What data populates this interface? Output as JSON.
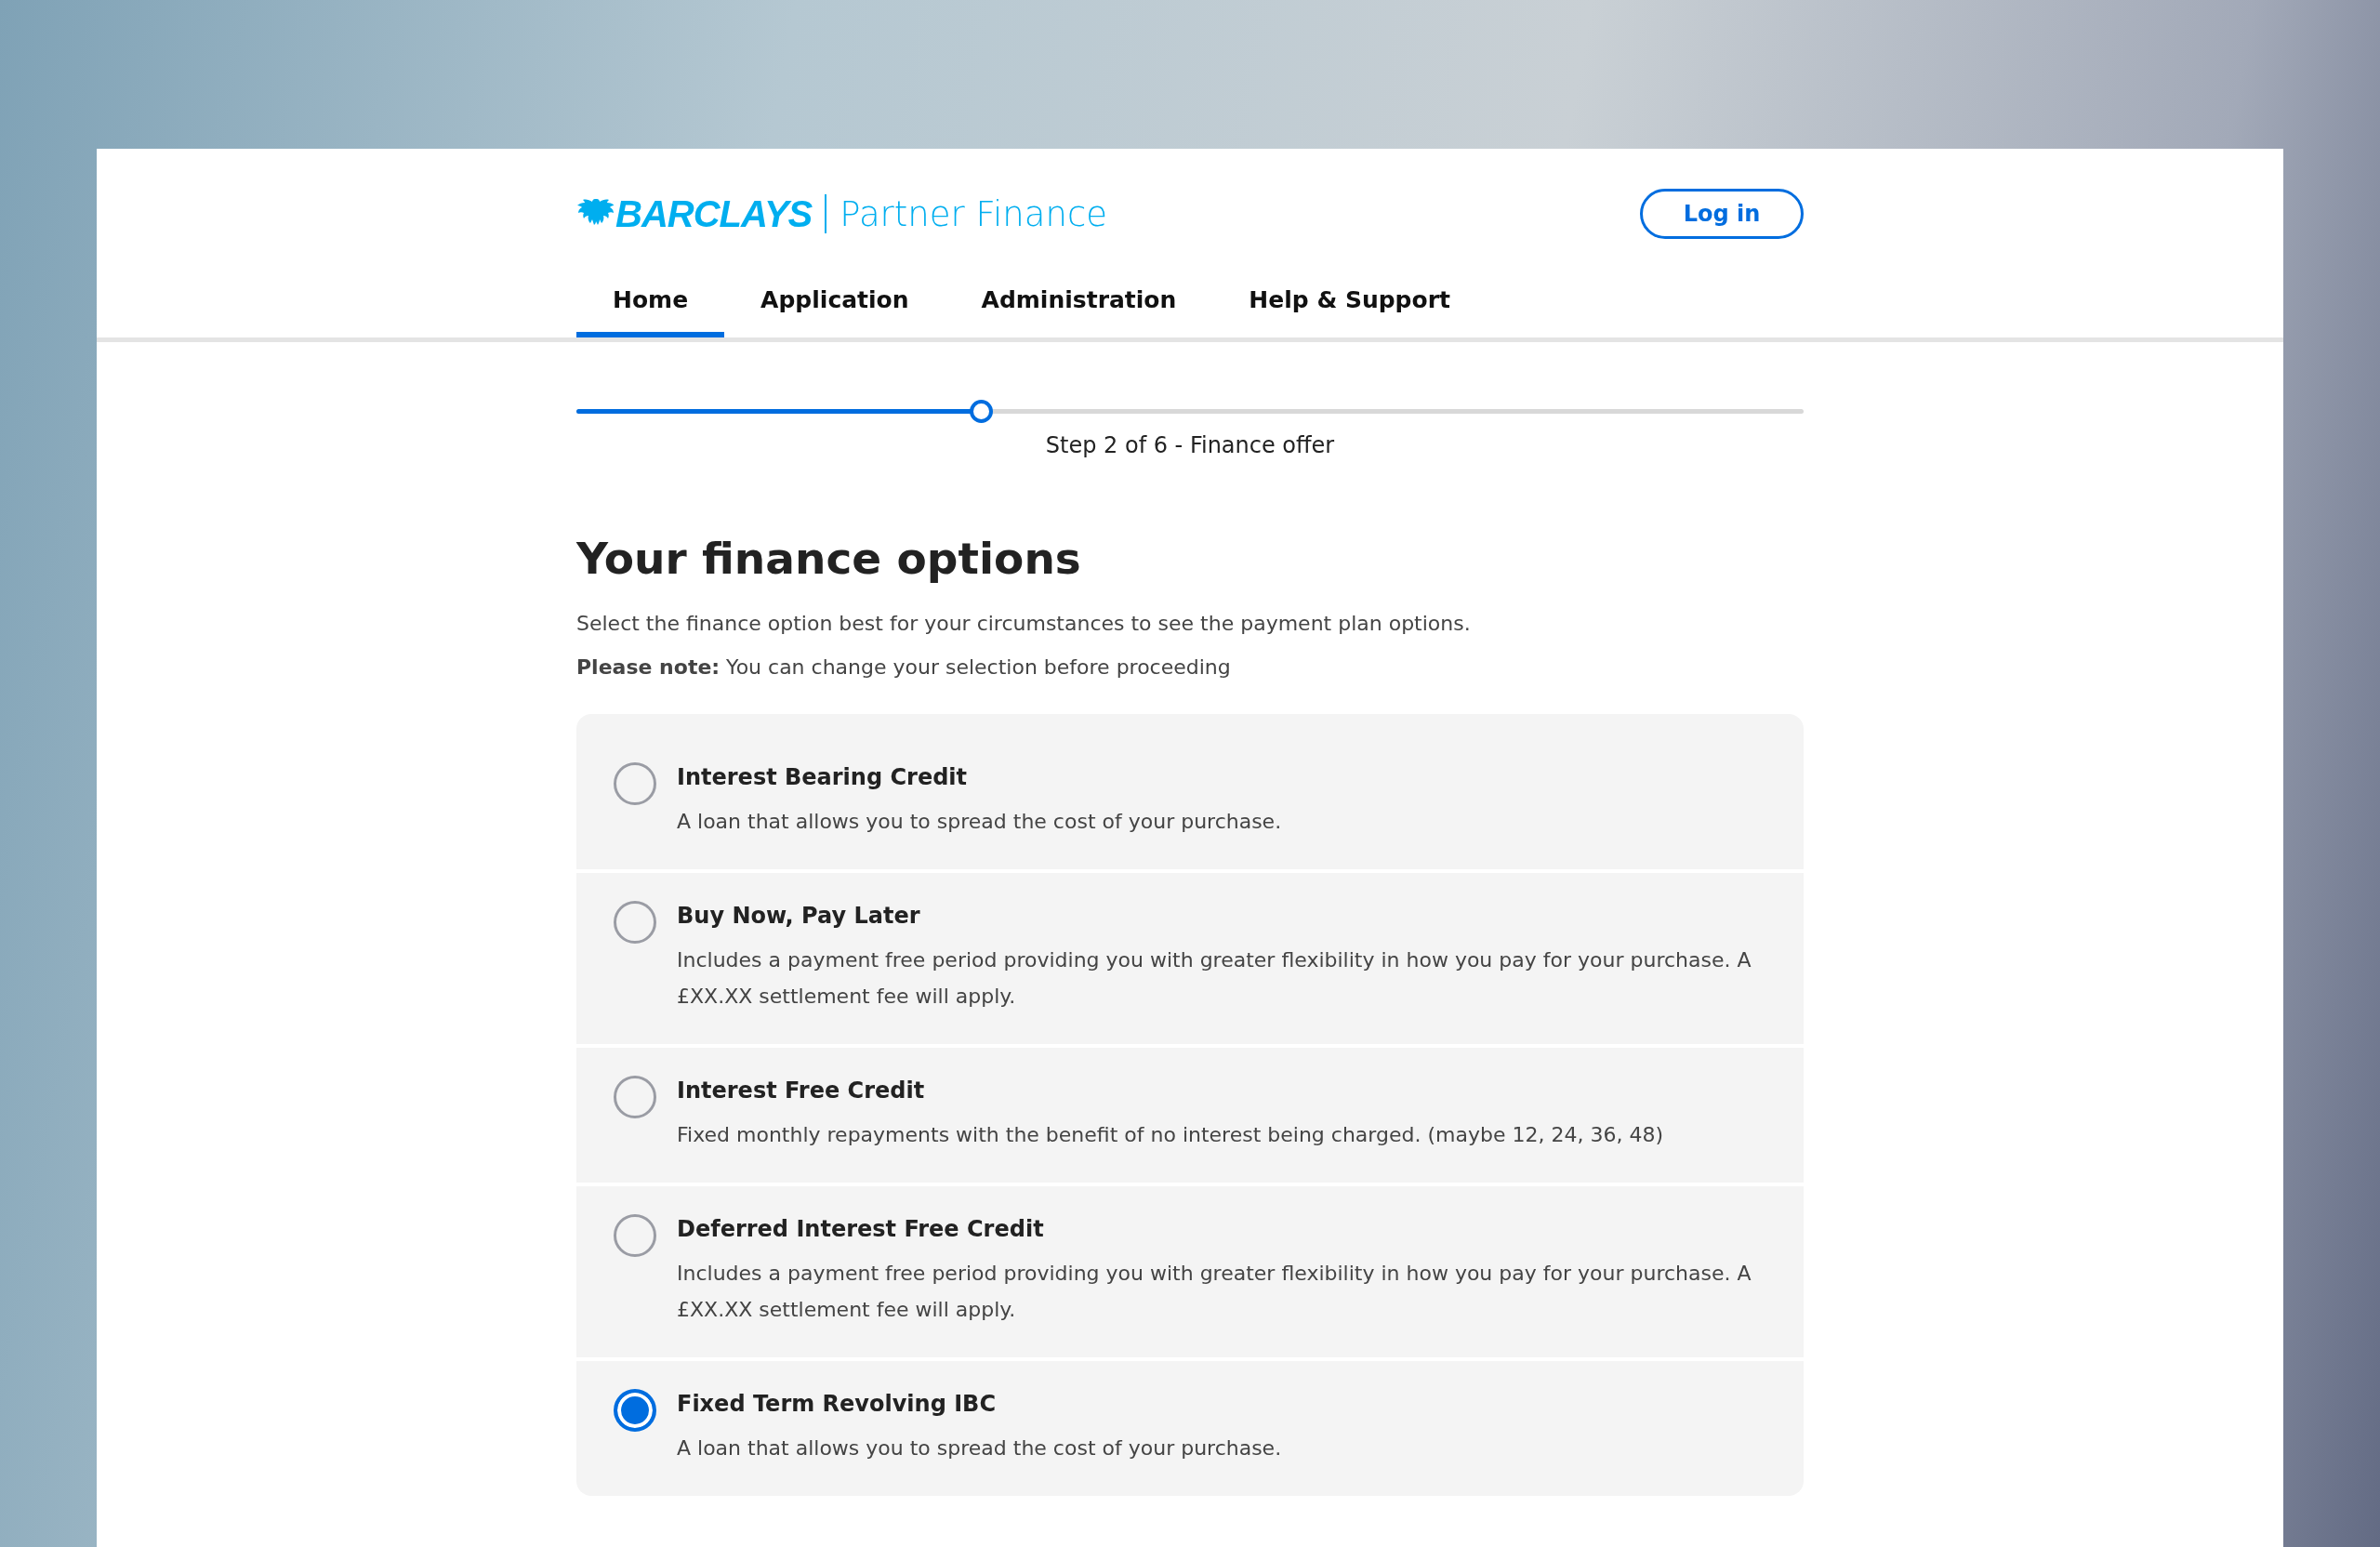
{
  "header": {
    "logo_text": "BARCLAYS",
    "product": "Partner Finance",
    "login_button": "Log in"
  },
  "nav": [
    {
      "label": "Home",
      "selected": true
    },
    {
      "label": "Application",
      "selected": false
    },
    {
      "label": "Administration",
      "selected": false
    },
    {
      "label": "Help & Support",
      "selected": false
    }
  ],
  "progress": {
    "level": 0.33,
    "label": "Step 2 of 6 - Finance offer"
  },
  "heading": "Your finance options",
  "intro": "Select the finance option best for your circumstances to see the payment plan options.",
  "note": "**Please note:** You can change your selection before proceeding",
  "options": [
    {
      "title": "Interest Bearing Credit",
      "description": "A loan that allows you to spread the cost of your purchase.",
      "selected": false
    },
    {
      "title": "Buy Now, Pay Later",
      "description": "Includes a payment free period providing you with greater flexibility in how you pay for your purchase. A £XX.XX settlement fee will apply.",
      "selected": false
    },
    {
      "title": "Interest Free Credit",
      "description": "Fixed monthly repayments with the benefit of no interest being charged. (maybe 12, 24, 36, 48)",
      "selected": false
    },
    {
      "title": "Deferred Interest Free Credit",
      "description": "Includes a payment free period providing you with greater flexibility in how you pay for your purchase. A £XX.XX settlement fee will apply.",
      "selected": false
    },
    {
      "title": "Fixed Term Revolving IBC",
      "description": "A loan that allows you to spread the cost of your purchase.",
      "selected": true
    }
  ]
}
